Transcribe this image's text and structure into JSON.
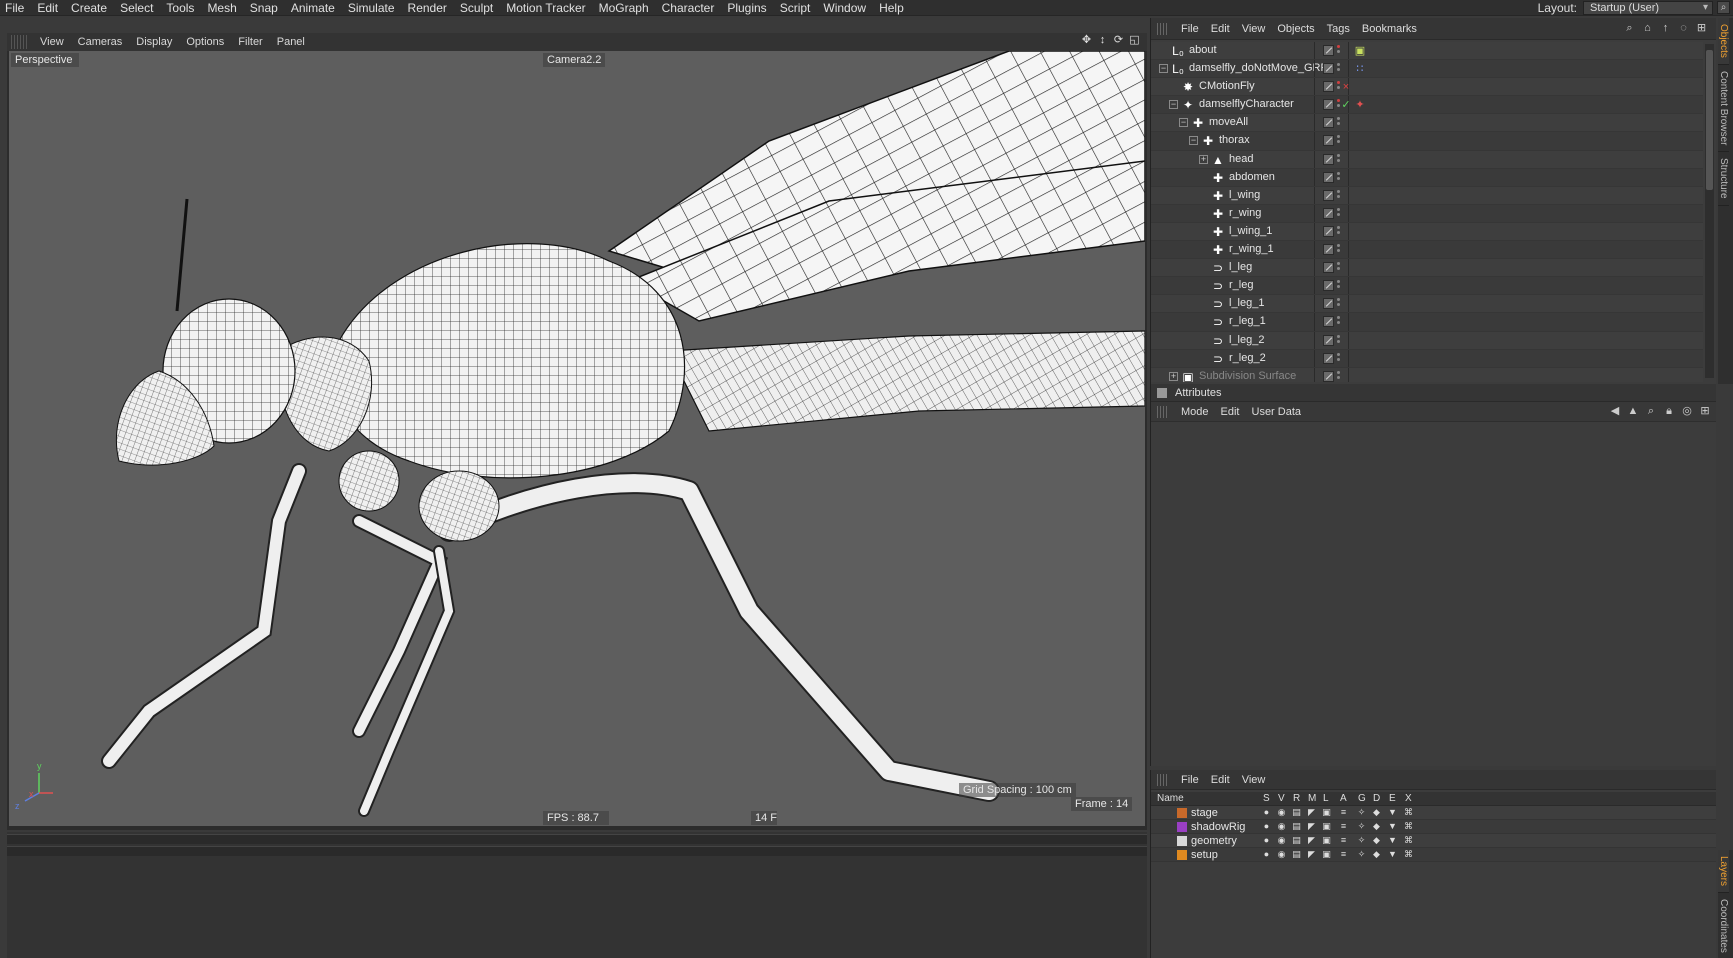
{
  "menubar": {
    "items": [
      "File",
      "Edit",
      "Create",
      "Select",
      "Tools",
      "Mesh",
      "Snap",
      "Animate",
      "Simulate",
      "Render",
      "Sculpt",
      "Motion Tracker",
      "MoGraph",
      "Character",
      "Plugins",
      "Script",
      "Window",
      "Help"
    ],
    "layout_label": "Layout:",
    "layout_value": "Startup (User)"
  },
  "viewport": {
    "menu": [
      "View",
      "Cameras",
      "Display",
      "Options",
      "Filter",
      "Panel"
    ],
    "view_name": "Perspective",
    "camera_name": "Camera2.2",
    "fps": "FPS : 88.7",
    "frame_count": "14 F",
    "grid_spacing": "Grid Spacing : 100 cm",
    "frame": "Frame : 14",
    "axis_y": "y",
    "axis_z": "z",
    "axis_x": "x"
  },
  "objects_panel": {
    "menu": [
      "File",
      "Edit",
      "View",
      "Objects",
      "Tags",
      "Bookmarks"
    ],
    "rows": [
      {
        "name": "about",
        "icon": "null-icon",
        "depth": 0,
        "expander": ""
      },
      {
        "name": "damselfly_doNotMove_GRP",
        "icon": "null-icon",
        "depth": 0,
        "expander": "-"
      },
      {
        "name": "CMotionFly",
        "icon": "cmotion-icon",
        "depth": 1,
        "expander": ""
      },
      {
        "name": "damselflyCharacter",
        "icon": "character-icon",
        "depth": 1,
        "expander": "-"
      },
      {
        "name": "moveAll",
        "icon": "joint-icon",
        "depth": 2,
        "expander": "-"
      },
      {
        "name": "thorax",
        "icon": "joint-icon",
        "depth": 3,
        "expander": "-"
      },
      {
        "name": "head",
        "icon": "head-icon",
        "depth": 4,
        "expander": "+"
      },
      {
        "name": "abdomen",
        "icon": "joint-icon",
        "depth": 4,
        "expander": ""
      },
      {
        "name": "l_wing",
        "icon": "joint-icon",
        "depth": 4,
        "expander": ""
      },
      {
        "name": "r_wing",
        "icon": "joint-icon",
        "depth": 4,
        "expander": ""
      },
      {
        "name": "l_wing_1",
        "icon": "joint-icon",
        "depth": 4,
        "expander": ""
      },
      {
        "name": "r_wing_1",
        "icon": "joint-icon",
        "depth": 4,
        "expander": ""
      },
      {
        "name": "l_leg",
        "icon": "leg-icon",
        "depth": 4,
        "expander": ""
      },
      {
        "name": "r_leg",
        "icon": "leg-icon",
        "depth": 4,
        "expander": ""
      },
      {
        "name": "l_leg_1",
        "icon": "leg-icon",
        "depth": 4,
        "expander": ""
      },
      {
        "name": "r_leg_1",
        "icon": "leg-icon",
        "depth": 4,
        "expander": ""
      },
      {
        "name": "l_leg_2",
        "icon": "leg-icon",
        "depth": 4,
        "expander": ""
      },
      {
        "name": "r_leg_2",
        "icon": "leg-icon",
        "depth": 4,
        "expander": ""
      },
      {
        "name": "Subdivision Surface",
        "icon": "subdivision-icon",
        "depth": 1,
        "expander": "+"
      }
    ]
  },
  "side_tabs_top": [
    "Objects",
    "Content Browser",
    "Structure"
  ],
  "attributes_panel": {
    "title": "Attributes",
    "menu": [
      "Mode",
      "Edit",
      "User Data"
    ]
  },
  "layers_panel": {
    "menu": [
      "File",
      "Edit",
      "View"
    ],
    "columns": [
      "Name",
      "S",
      "V",
      "R",
      "M",
      "L",
      "A",
      "G",
      "D",
      "E",
      "X"
    ],
    "rows": [
      {
        "name": "stage",
        "color": "#c8692a"
      },
      {
        "name": "shadowRig",
        "color": "#9a3fc4"
      },
      {
        "name": "geometry",
        "color": "#d8d8d8"
      },
      {
        "name": "setup",
        "color": "#e08a20"
      }
    ]
  },
  "side_tabs_bottom": [
    "Layers",
    "Coordinates"
  ],
  "colors": {
    "accent": "#f0a030",
    "viewport_bg": "#5e5e5e",
    "panel_bg": "#3c3c3c"
  }
}
